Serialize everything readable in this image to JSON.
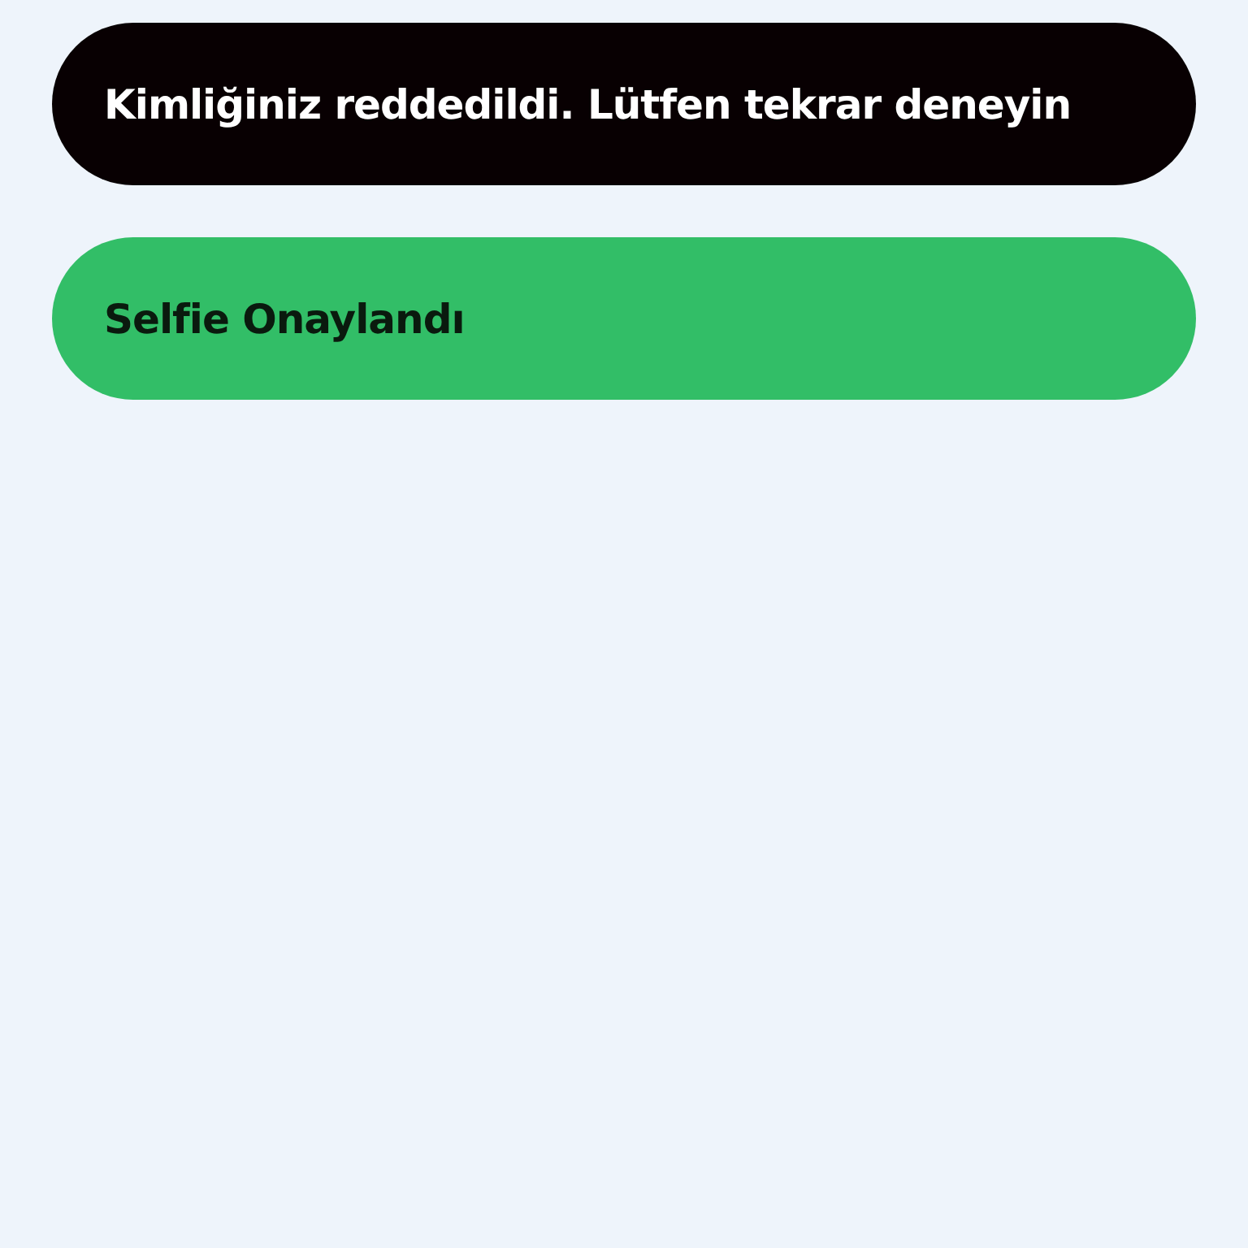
{
  "toasts": [
    {
      "kind": "error",
      "message": "Kimliğiniz reddedildi. Lütfen tekrar deneyin"
    },
    {
      "kind": "success",
      "message": "Selfie Onaylandı"
    }
  ]
}
